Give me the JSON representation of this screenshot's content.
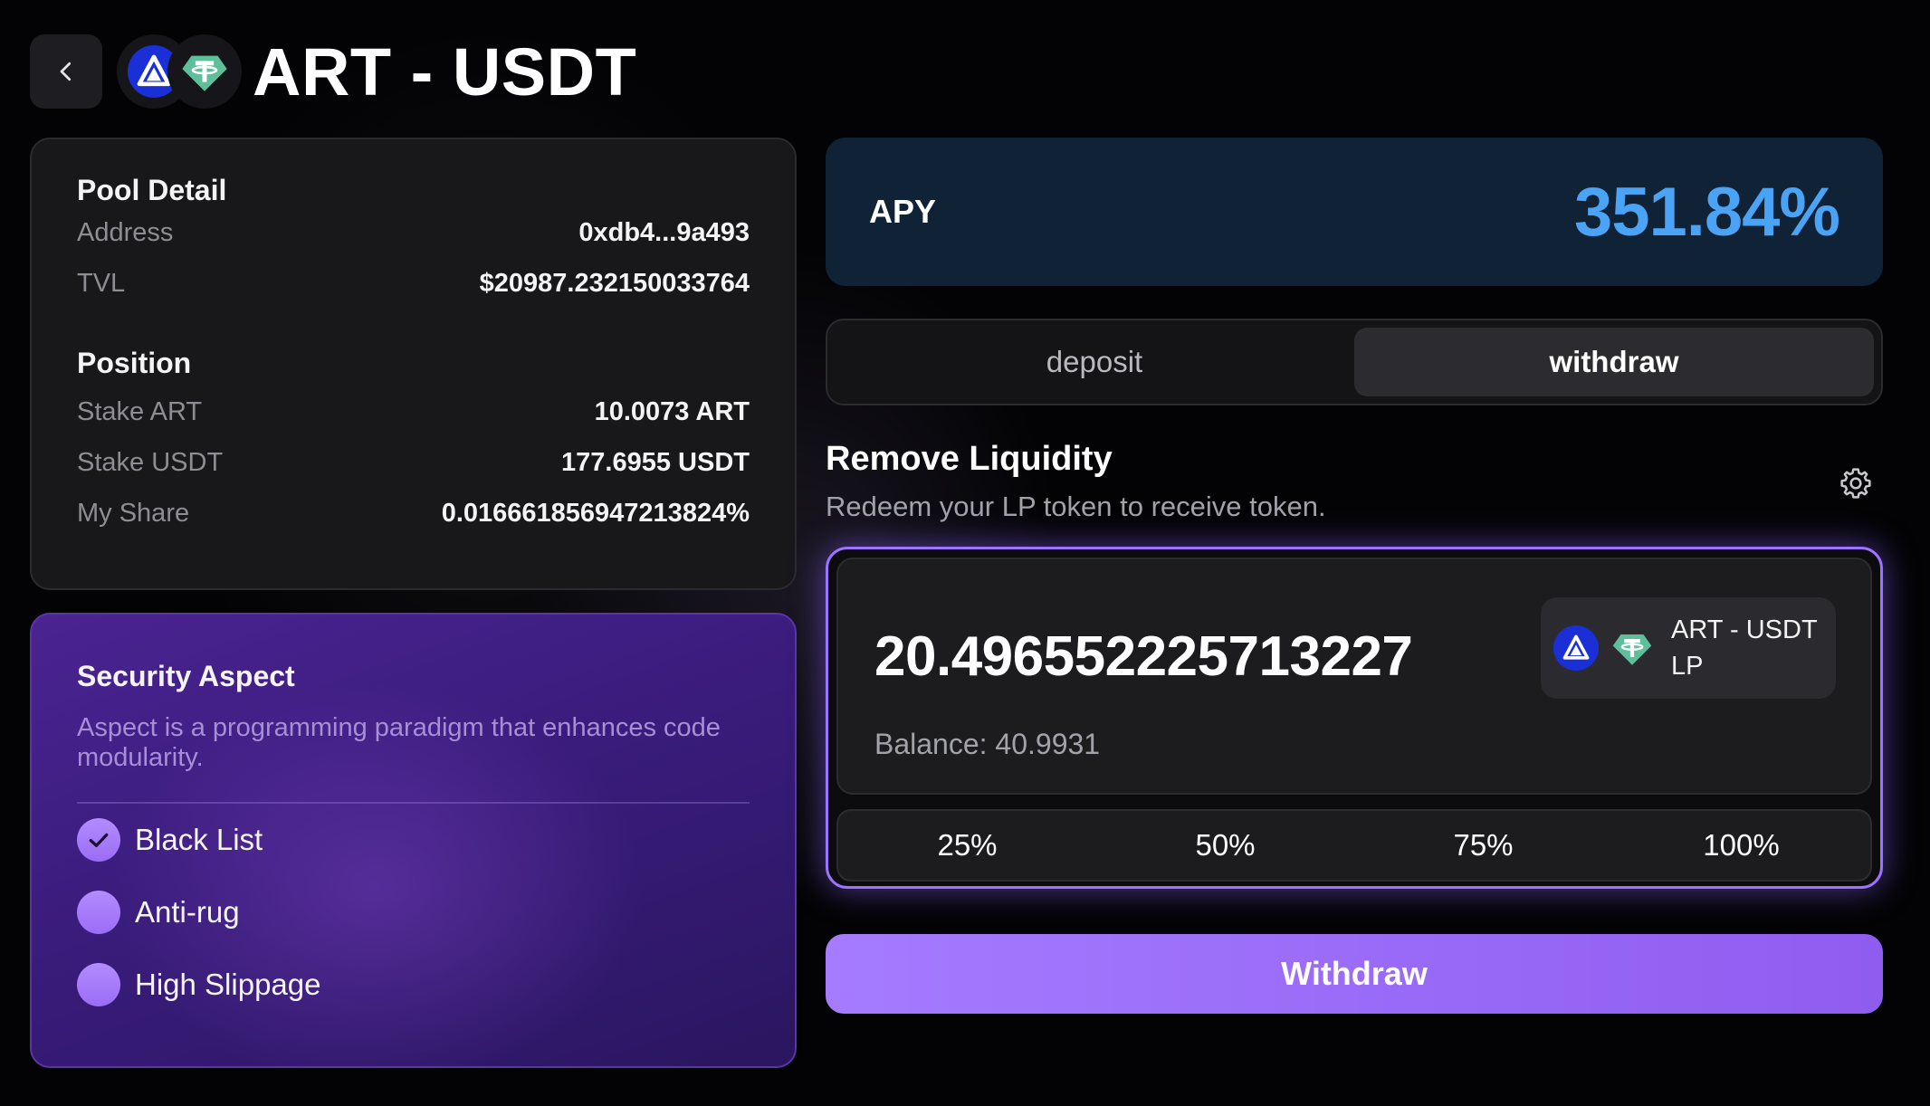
{
  "header": {
    "title": "ART - USDT",
    "back_icon": "chevron-left-icon",
    "token_icons": [
      "art-token-icon",
      "usdt-token-icon"
    ]
  },
  "pool_detail": {
    "title": "Pool Detail",
    "address_label": "Address",
    "address_value": "0xdb4...9a493",
    "tvl_label": "TVL",
    "tvl_value": "$20987.232150033764"
  },
  "position": {
    "title": "Position",
    "stake_art_label": "Stake ART",
    "stake_art_value": "10.0073 ART",
    "stake_usdt_label": "Stake USDT",
    "stake_usdt_value": "177.6955 USDT",
    "share_label": "My Share",
    "share_value": "0.016661856947213824%"
  },
  "security": {
    "title": "Security Aspect",
    "description": "Aspect is a programming paradigm that enhances code modularity.",
    "items": [
      {
        "label": "Black List",
        "checked": true
      },
      {
        "label": "Anti-rug",
        "checked": false
      },
      {
        "label": "High Slippage",
        "checked": false
      }
    ]
  },
  "apy": {
    "label": "APY",
    "value": "351.84%"
  },
  "tabs": [
    {
      "label": "deposit",
      "active": false
    },
    {
      "label": "withdraw",
      "active": true
    }
  ],
  "remove": {
    "title": "Remove Liquidity",
    "subtitle": "Redeem your LP token to receive token.",
    "amount": "20.496552225713227",
    "balance": "Balance: 40.9931",
    "lp_label_line1": "ART - USDT",
    "lp_label_line2": "LP",
    "percents": [
      "25%",
      "50%",
      "75%",
      "100%"
    ]
  },
  "withdraw_button": "Withdraw",
  "colors": {
    "accent": "#9d72ff",
    "apy": "#4aa3f5",
    "art_blue": "#1a2fd6",
    "usdt_green": "#4fae8f"
  }
}
